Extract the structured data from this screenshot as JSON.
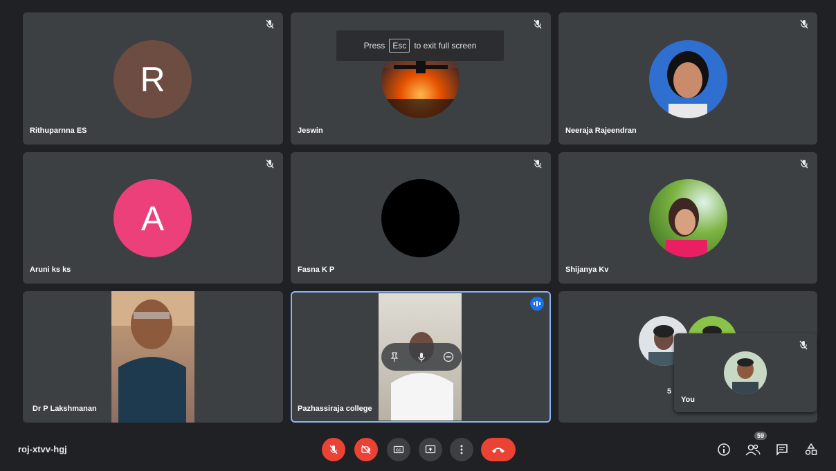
{
  "toast": {
    "press": "Press",
    "key": "Esc",
    "rest": "to exit full screen"
  },
  "participants": [
    {
      "name": "Rithuparnna ES",
      "initial": "R",
      "color": "#6d4c41"
    },
    {
      "name": "Jeswin"
    },
    {
      "name": "Neeraja Rajeendran"
    },
    {
      "name": "Aruni ks ks",
      "initial": "A",
      "color": "#ec407a"
    },
    {
      "name": "Fasna K P"
    },
    {
      "name": "Shijanya Kv"
    },
    {
      "name": "Dr P Lakshmanan"
    },
    {
      "name": "Pazhassiraja college"
    },
    {
      "name": "5"
    }
  ],
  "self_view": {
    "name": "You"
  },
  "bottom": {
    "meeting_code": "roj-xtvv-hgj",
    "participant_count": "59"
  },
  "icons": {
    "mic_off": "mic-off-icon",
    "cam_off": "camera-off-icon",
    "captions": "captions-icon",
    "present": "present-icon",
    "more": "more-vert-icon",
    "hangup": "hangup-icon",
    "info": "info-icon",
    "people": "people-icon",
    "chat": "chat-icon",
    "activities": "activities-icon"
  },
  "colors": {
    "background": "#202124",
    "tile": "#3c4043",
    "red": "#ea4335",
    "accent": "#8ab4f8"
  }
}
